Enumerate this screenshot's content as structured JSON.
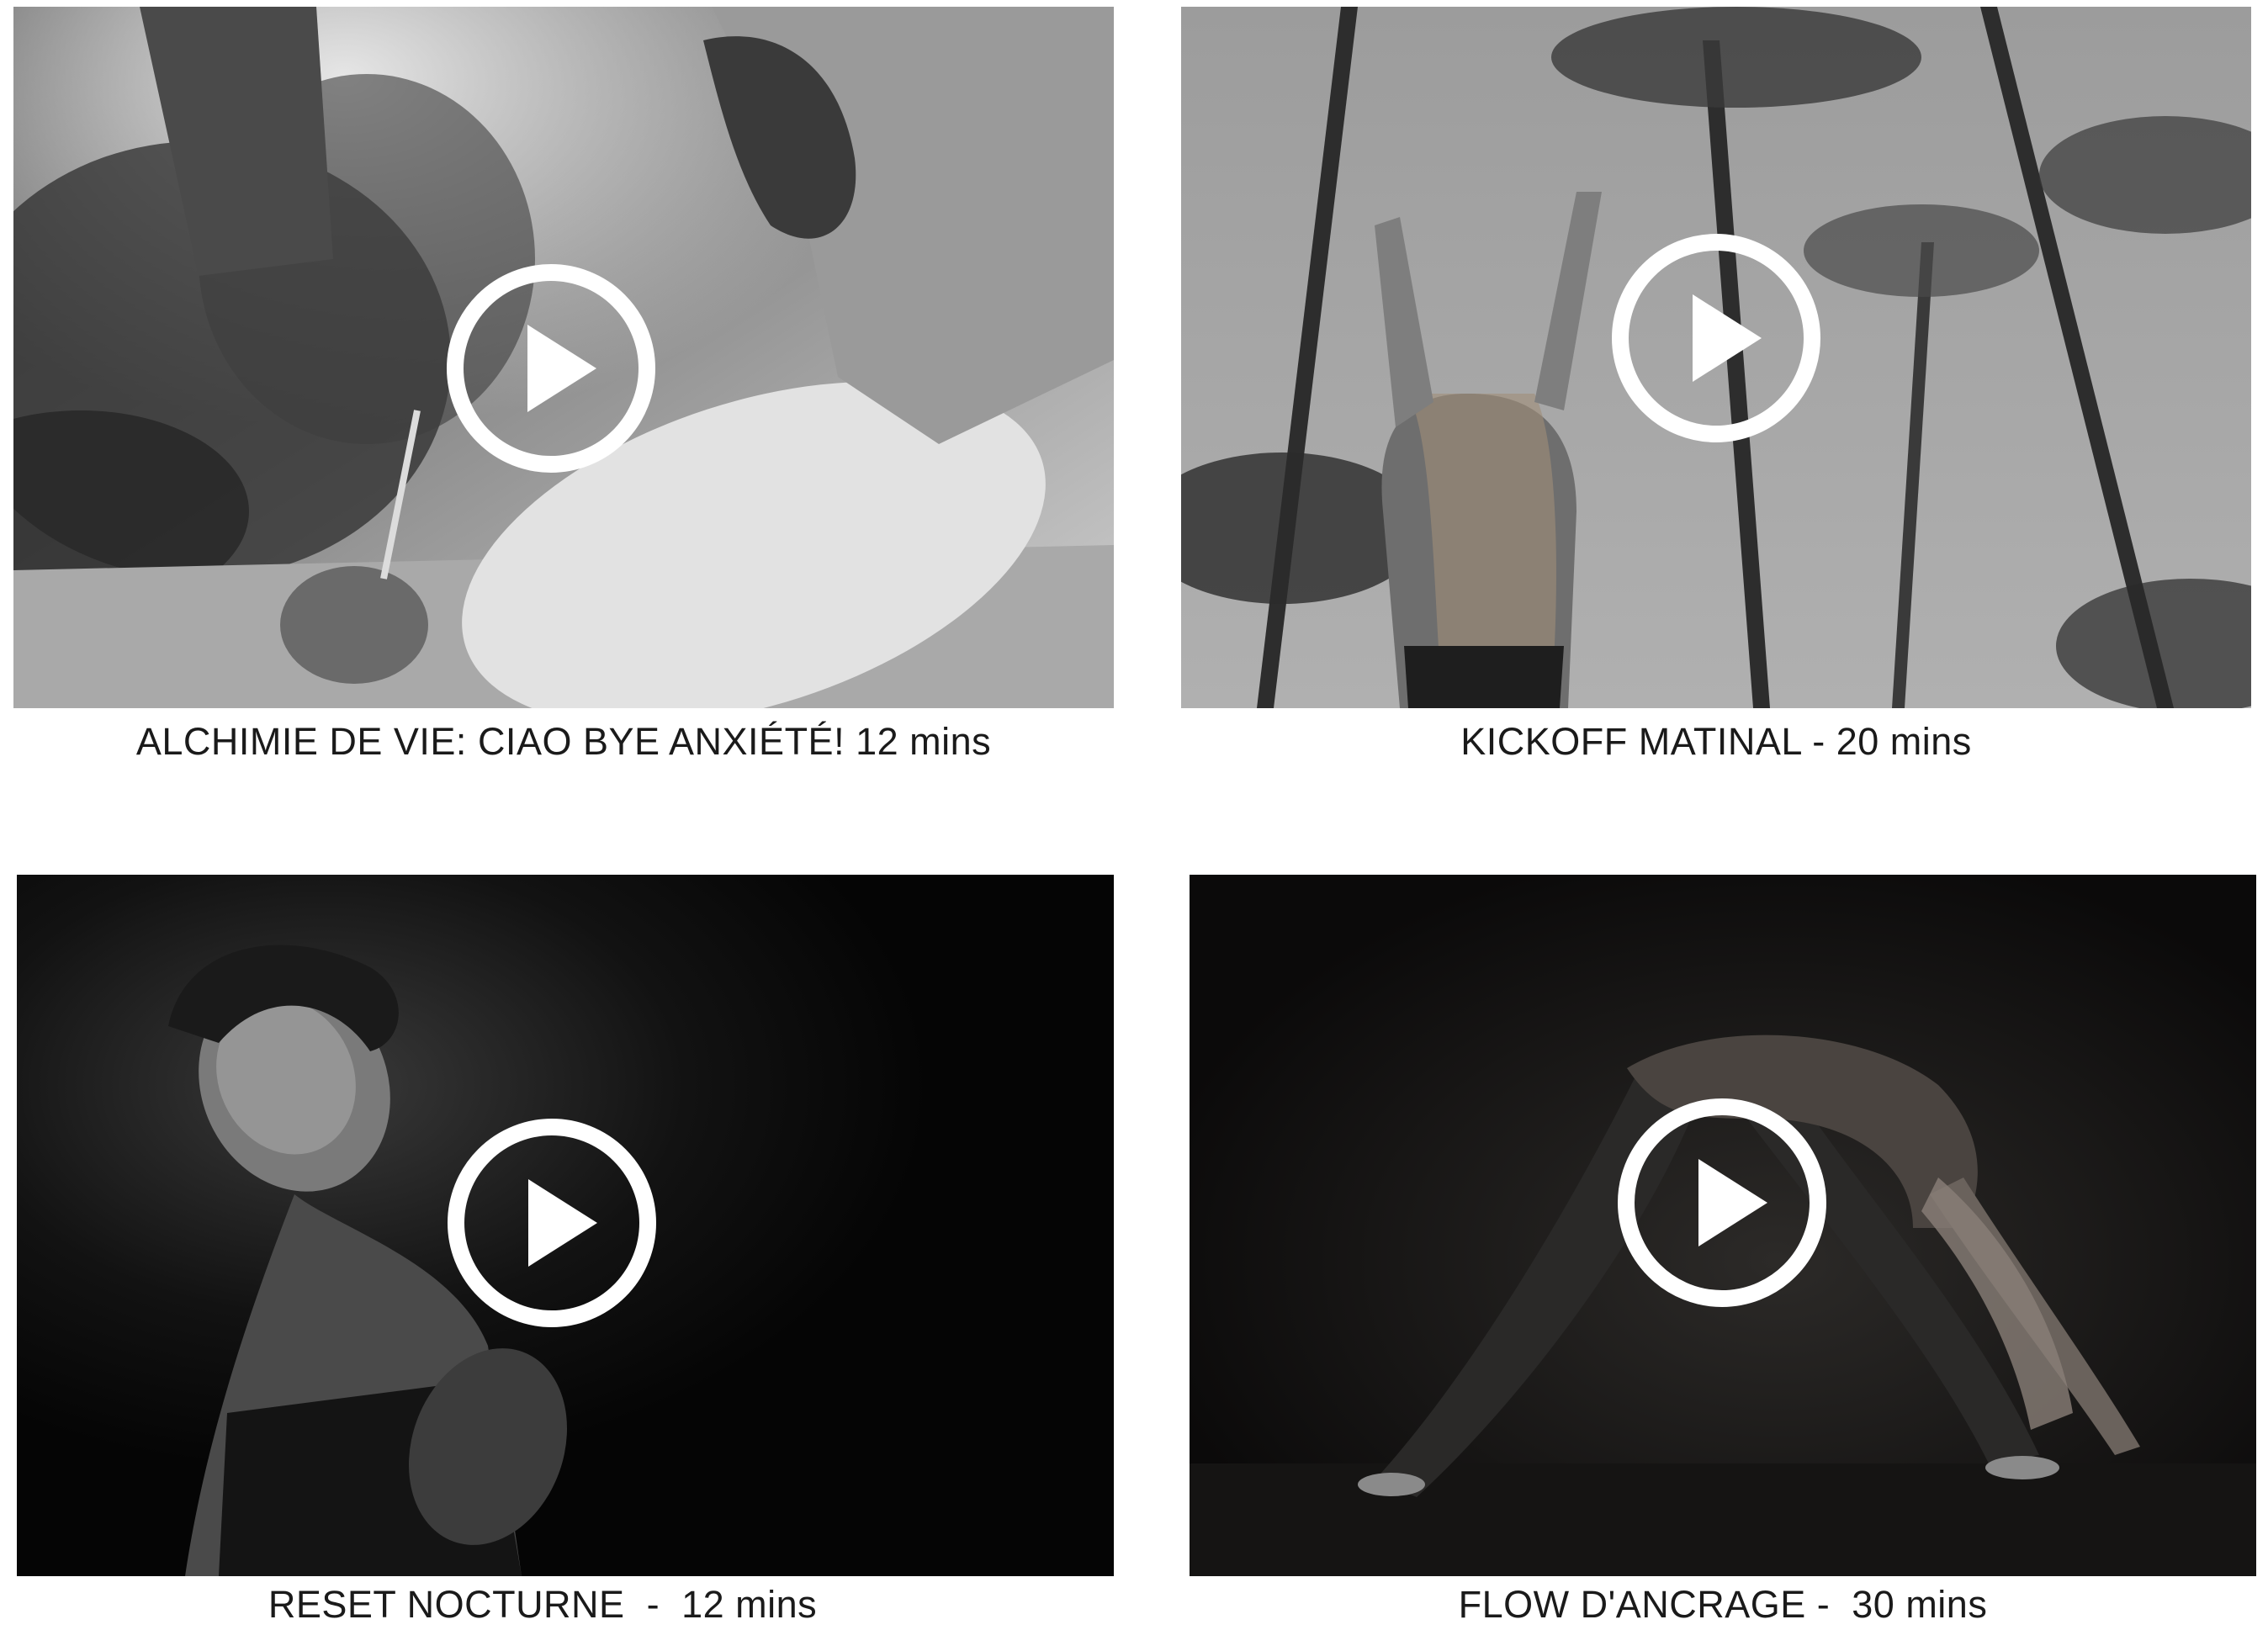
{
  "videos": [
    {
      "title": "ALCHIMIE DE VIE: CIAO BYE ANXIÉTÉ! 12 mins",
      "play_icon": "play-circle-icon",
      "tone": "light-grey-tropical"
    },
    {
      "title": "KICKOFF MATINAL - 20 mins",
      "play_icon": "play-circle-icon",
      "tone": "grey-palm-sky"
    },
    {
      "title": "RESET NOCTURNE  -  12 mins",
      "play_icon": "play-circle-icon",
      "tone": "dark-low-key"
    },
    {
      "title": "FLOW D'ANCRAGE -  30 mins",
      "play_icon": "play-circle-icon",
      "tone": "dark-stage"
    }
  ],
  "colors": {
    "page_background": "#ffffff",
    "caption_text": "#1a1a1a",
    "play_icon": "#ffffff"
  }
}
